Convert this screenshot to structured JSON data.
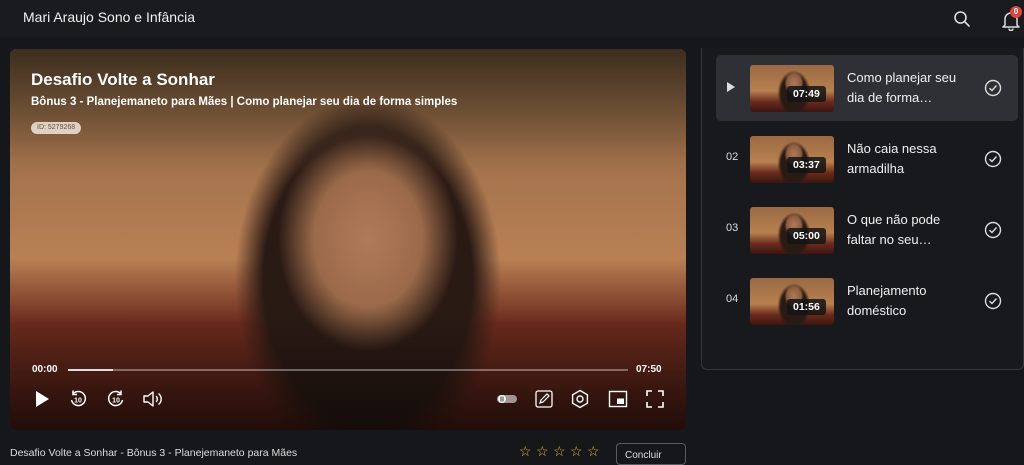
{
  "header": {
    "brand": "Mari Araujo Sono e Infância",
    "notification_count": "0",
    "search_icon": "search-icon",
    "bell_icon": "bell-icon"
  },
  "player": {
    "title": "Desafio Volte a Sonhar",
    "subtitle": "Bônus 3 - Planejemaneto para Mães | Como planejar seu dia de forma simples",
    "id_label": "ID: 5279268",
    "current_time": "00:00",
    "total_time": "07:50",
    "progress": 0.08,
    "controls": {
      "play": "play-icon",
      "rewind": "rewind-10-icon",
      "rewind_label": "10",
      "forward": "forward-10-icon",
      "forward_label": "10",
      "volume": "volume-icon",
      "toggle": "toggle-icon",
      "notes": "pencil-icon",
      "settings": "settings-icon",
      "pip": "picture-in-picture-icon",
      "fullscreen": "fullscreen-icon"
    }
  },
  "below": {
    "lesson_title": "Desafio Volte a Sonhar - Bônus 3 - Planejemaneto para Mães",
    "rating_stars": 5,
    "complete_label": "Concluir"
  },
  "playlist": {
    "items": [
      {
        "number": "",
        "duration": "07:49",
        "title": "Como planejar seu dia de forma…",
        "active": true
      },
      {
        "number": "02",
        "duration": "03:37",
        "title": "Não caia nessa armadilha",
        "active": false
      },
      {
        "number": "03",
        "duration": "05:00",
        "title": "O que não pode faltar no seu…",
        "active": false
      },
      {
        "number": "04",
        "duration": "01:56",
        "title": "Planejamento doméstico",
        "active": false
      }
    ]
  },
  "colors": {
    "background": "#16171a",
    "badge": "#e0433b",
    "star": "#e6b33a",
    "active_item": "#2e3035"
  }
}
